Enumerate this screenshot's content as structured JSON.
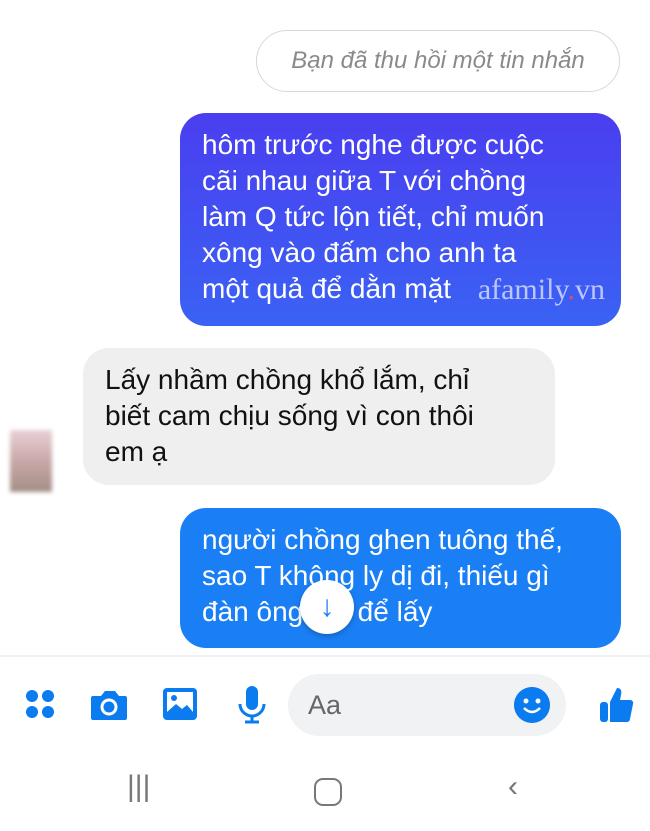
{
  "messages": [
    {
      "id": "recalled",
      "text": "Bạn đã thu hồi một tin nhắn",
      "sender": "me"
    },
    {
      "id": "m1",
      "text": "hôm trước nghe được cuộc\ncãi nhau giữa T với chồng\nlàm Q tức lộn tiết, chỉ muốn\nxông vào đấm cho anh ta\nmột quả để dằn mặt",
      "sender": "me"
    },
    {
      "id": "m2",
      "text": "Lấy nhầm chồng khổ lắm, chỉ\nbiết cam chịu sống vì con thôi\nem ạ",
      "sender": "other"
    },
    {
      "id": "m3",
      "text": "người chồng ghen tuông thế,\nsao T không ly dị đi, thiếu gì\nđàn ông mà để lấy",
      "sender": "me"
    }
  ],
  "watermark": {
    "main": "afamily",
    "dot": ".",
    "tld": "vn"
  },
  "composer": {
    "placeholder": "Aa"
  },
  "colors": {
    "accent": "#0a7cf0",
    "bubble_gradient_top": "#4a3ef0",
    "bubble_gradient_bottom": "#3a62f4",
    "bubble_blue": "#1a7ff5",
    "incoming": "#efefef"
  },
  "icons": [
    "apps-icon",
    "camera-icon",
    "image-icon",
    "microphone-icon",
    "emoji-icon",
    "like-icon",
    "scroll-down-icon",
    "recent-apps-icon",
    "home-icon",
    "back-icon"
  ]
}
